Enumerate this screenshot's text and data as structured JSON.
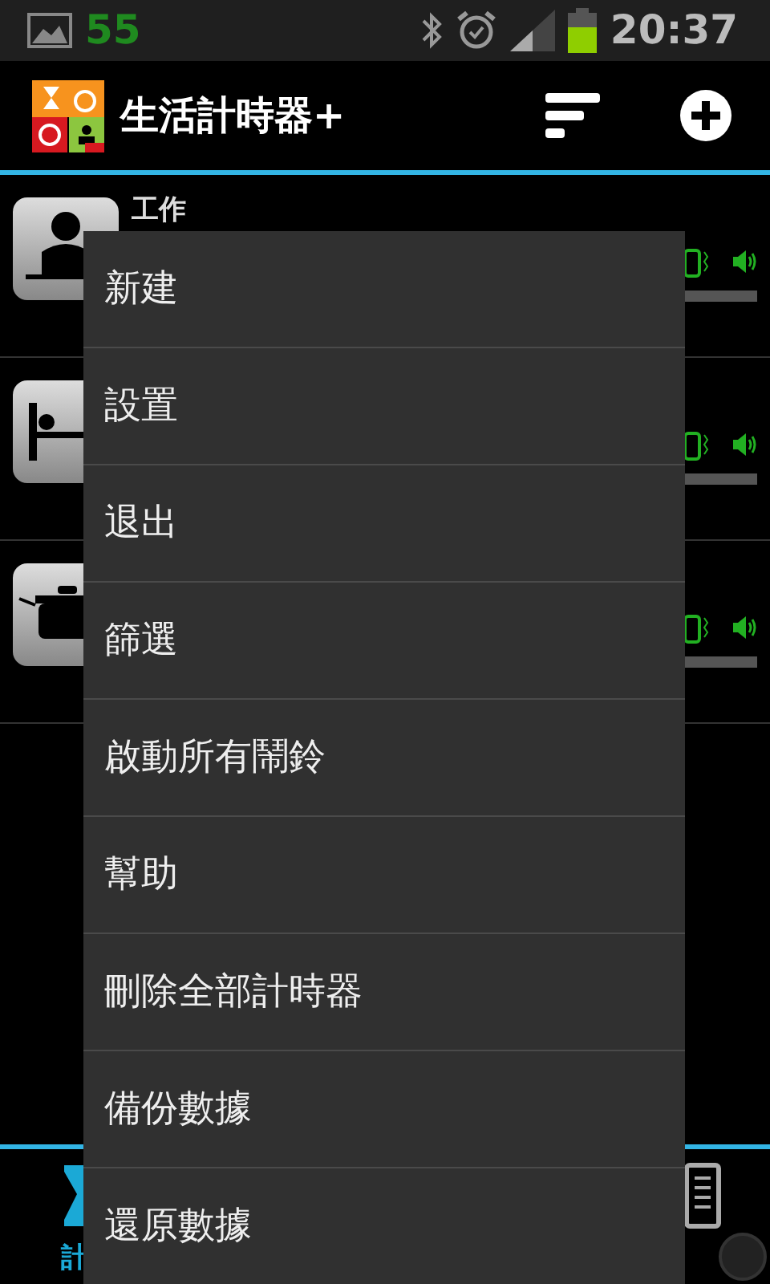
{
  "status_bar": {
    "count": "55",
    "time": "20:37"
  },
  "action_bar": {
    "title": "生活計時器+"
  },
  "timers": [
    {
      "kind": "work",
      "title": "工作",
      "level": 1
    },
    {
      "kind": "sleep",
      "level": 1
    },
    {
      "kind": "cooking",
      "level": 1
    }
  ],
  "menu": {
    "items": [
      {
        "label": "新建"
      },
      {
        "label": "設置"
      },
      {
        "label": "退出"
      },
      {
        "label": "篩選"
      },
      {
        "label": "啟動所有鬧鈴"
      },
      {
        "label": "幫助"
      },
      {
        "label": "刪除全部計時器"
      },
      {
        "label": "備份數據"
      },
      {
        "label": "還原數據"
      }
    ]
  },
  "bottom_tabs": [
    {
      "label": "計",
      "selected": true
    },
    {
      "selected": false
    }
  ]
}
